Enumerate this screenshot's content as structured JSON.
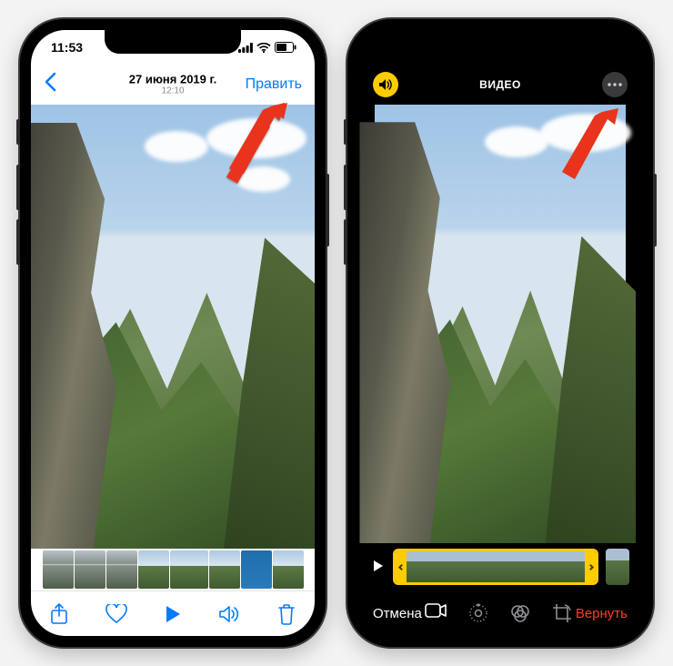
{
  "left": {
    "status": {
      "time": "11:53"
    },
    "nav": {
      "date": "27 июня 2019 г.",
      "time": "12:10",
      "edit_label": "Править"
    }
  },
  "right": {
    "top": {
      "title": "ВИДЕО"
    },
    "bottom": {
      "cancel_label": "Отмена",
      "revert_label": "Вернуть"
    }
  },
  "icons": {
    "back": "‹",
    "signal": "signal-icon",
    "wifi": "wifi-icon",
    "battery": "battery-icon",
    "sound": "speaker-icon",
    "more": "ellipsis-icon",
    "share": "share-icon",
    "heart": "heart-icon",
    "play": "play-icon",
    "volume": "volume-icon",
    "trash": "trash-icon",
    "video_tool": "video-icon",
    "adjust_tool": "adjust-icon",
    "filters_tool": "filters-icon",
    "crop_tool": "crop-icon"
  },
  "colors": {
    "ios_blue": "#007aff",
    "ios_yellow": "#ffcc00",
    "ios_red": "#ff3b30"
  }
}
